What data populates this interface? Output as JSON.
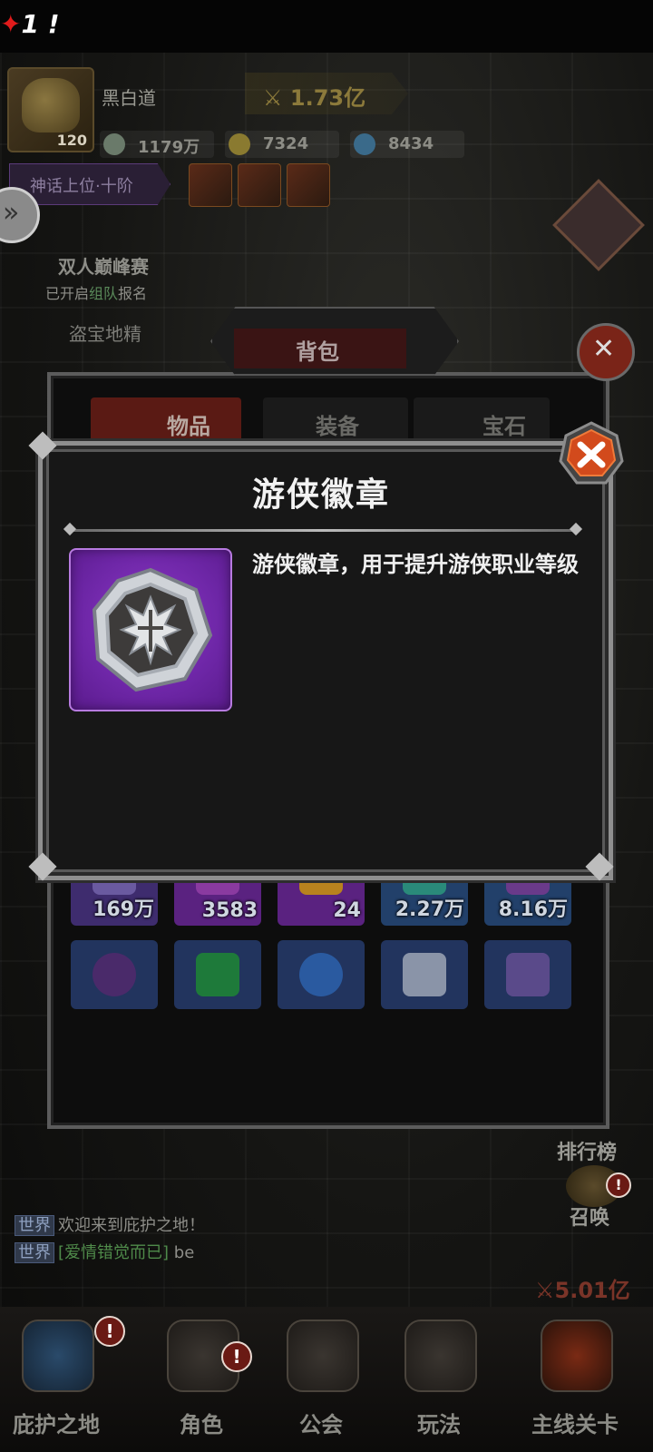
{
  "status_bar": {
    "alert_number": "1",
    "alert_mark": "!"
  },
  "player": {
    "name": "黑白道",
    "level": "120",
    "power": "1.73亿",
    "rank": "神话上位·十阶"
  },
  "resources": [
    {
      "icon": "silver-coin-icon",
      "value": "1179万"
    },
    {
      "icon": "gold-coin-icon",
      "value": "7324"
    },
    {
      "icon": "blue-gem-icon",
      "value": "8434"
    }
  ],
  "event": {
    "title": "双人巅峰赛",
    "subtitle_prefix": "已开启",
    "subtitle_highlight": "组队",
    "subtitle_suffix": "报名",
    "secondary": "盗宝地精"
  },
  "backpack": {
    "title": "背包",
    "tabs": [
      "物品",
      "装备",
      "宝石"
    ],
    "slots_row1": [
      {
        "count": "169万",
        "color": "#4a3280"
      },
      {
        "count": "3583",
        "color": "#6a2a8a"
      },
      {
        "count": "24",
        "color": "#6a2a8a"
      },
      {
        "count": "2.27万",
        "color": "#2a4a7a"
      },
      {
        "count": "8.16万",
        "color": "#2a4a7a"
      }
    ],
    "slots_row2": [
      {
        "count": "",
        "color": "#2a3a6a"
      },
      {
        "count": "",
        "color": "#2a3a6a"
      },
      {
        "count": "",
        "color": "#2a3a6a"
      },
      {
        "count": "",
        "color": "#2a3a6a"
      },
      {
        "count": "",
        "color": "#2a3a6a"
      }
    ]
  },
  "dialog": {
    "title": "游侠徽章",
    "description": "游侠徽章，用于提升游侠职业等级",
    "item_icon": "ranger-badge-icon",
    "frame_color": "#7a2fb8"
  },
  "chat": [
    {
      "channel": "世界",
      "text": "欢迎来到庇护之地！",
      "nick": ""
    },
    {
      "channel": "世界",
      "text": " be",
      "nick": "[爱情错觉而已]"
    }
  ],
  "right_menu": {
    "leaderboard": "排行榜",
    "summon": "召唤",
    "badge": "!"
  },
  "stage_power": "5.01亿",
  "bottom_nav": [
    "庇护之地",
    "角色",
    "公会",
    "玩法",
    "主线关卡"
  ]
}
